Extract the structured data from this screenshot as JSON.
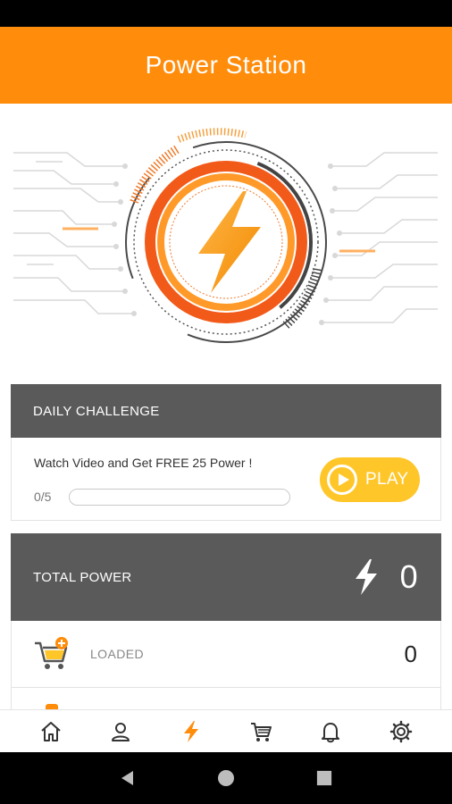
{
  "app": {
    "title": "Power Station"
  },
  "colors": {
    "accent": "#ff8c0a",
    "yellow": "#ffc629",
    "header_gray": "#5a5a5a"
  },
  "daily_challenge": {
    "title": "DAILY CHALLENGE",
    "text": "Watch Video and Get FREE 25 Power !",
    "progress_label": "0/5",
    "progress": 0,
    "play_label": "PLAY"
  },
  "total_power": {
    "label": "TOTAL POWER",
    "value": "0",
    "icon": "bolt-icon"
  },
  "loaded": {
    "label": "LOADED",
    "value": "0",
    "icon": "cart-add-icon"
  },
  "bottom_nav": {
    "items": [
      {
        "icon": "home-icon",
        "active": false
      },
      {
        "icon": "person-icon",
        "active": false
      },
      {
        "icon": "bolt-icon",
        "active": true
      },
      {
        "icon": "cart-icon",
        "active": false
      },
      {
        "icon": "bell-icon",
        "active": false
      },
      {
        "icon": "gear-icon",
        "active": false
      }
    ]
  },
  "system_nav": {
    "items": [
      "back-icon",
      "home-circle-icon",
      "recents-icon"
    ]
  }
}
